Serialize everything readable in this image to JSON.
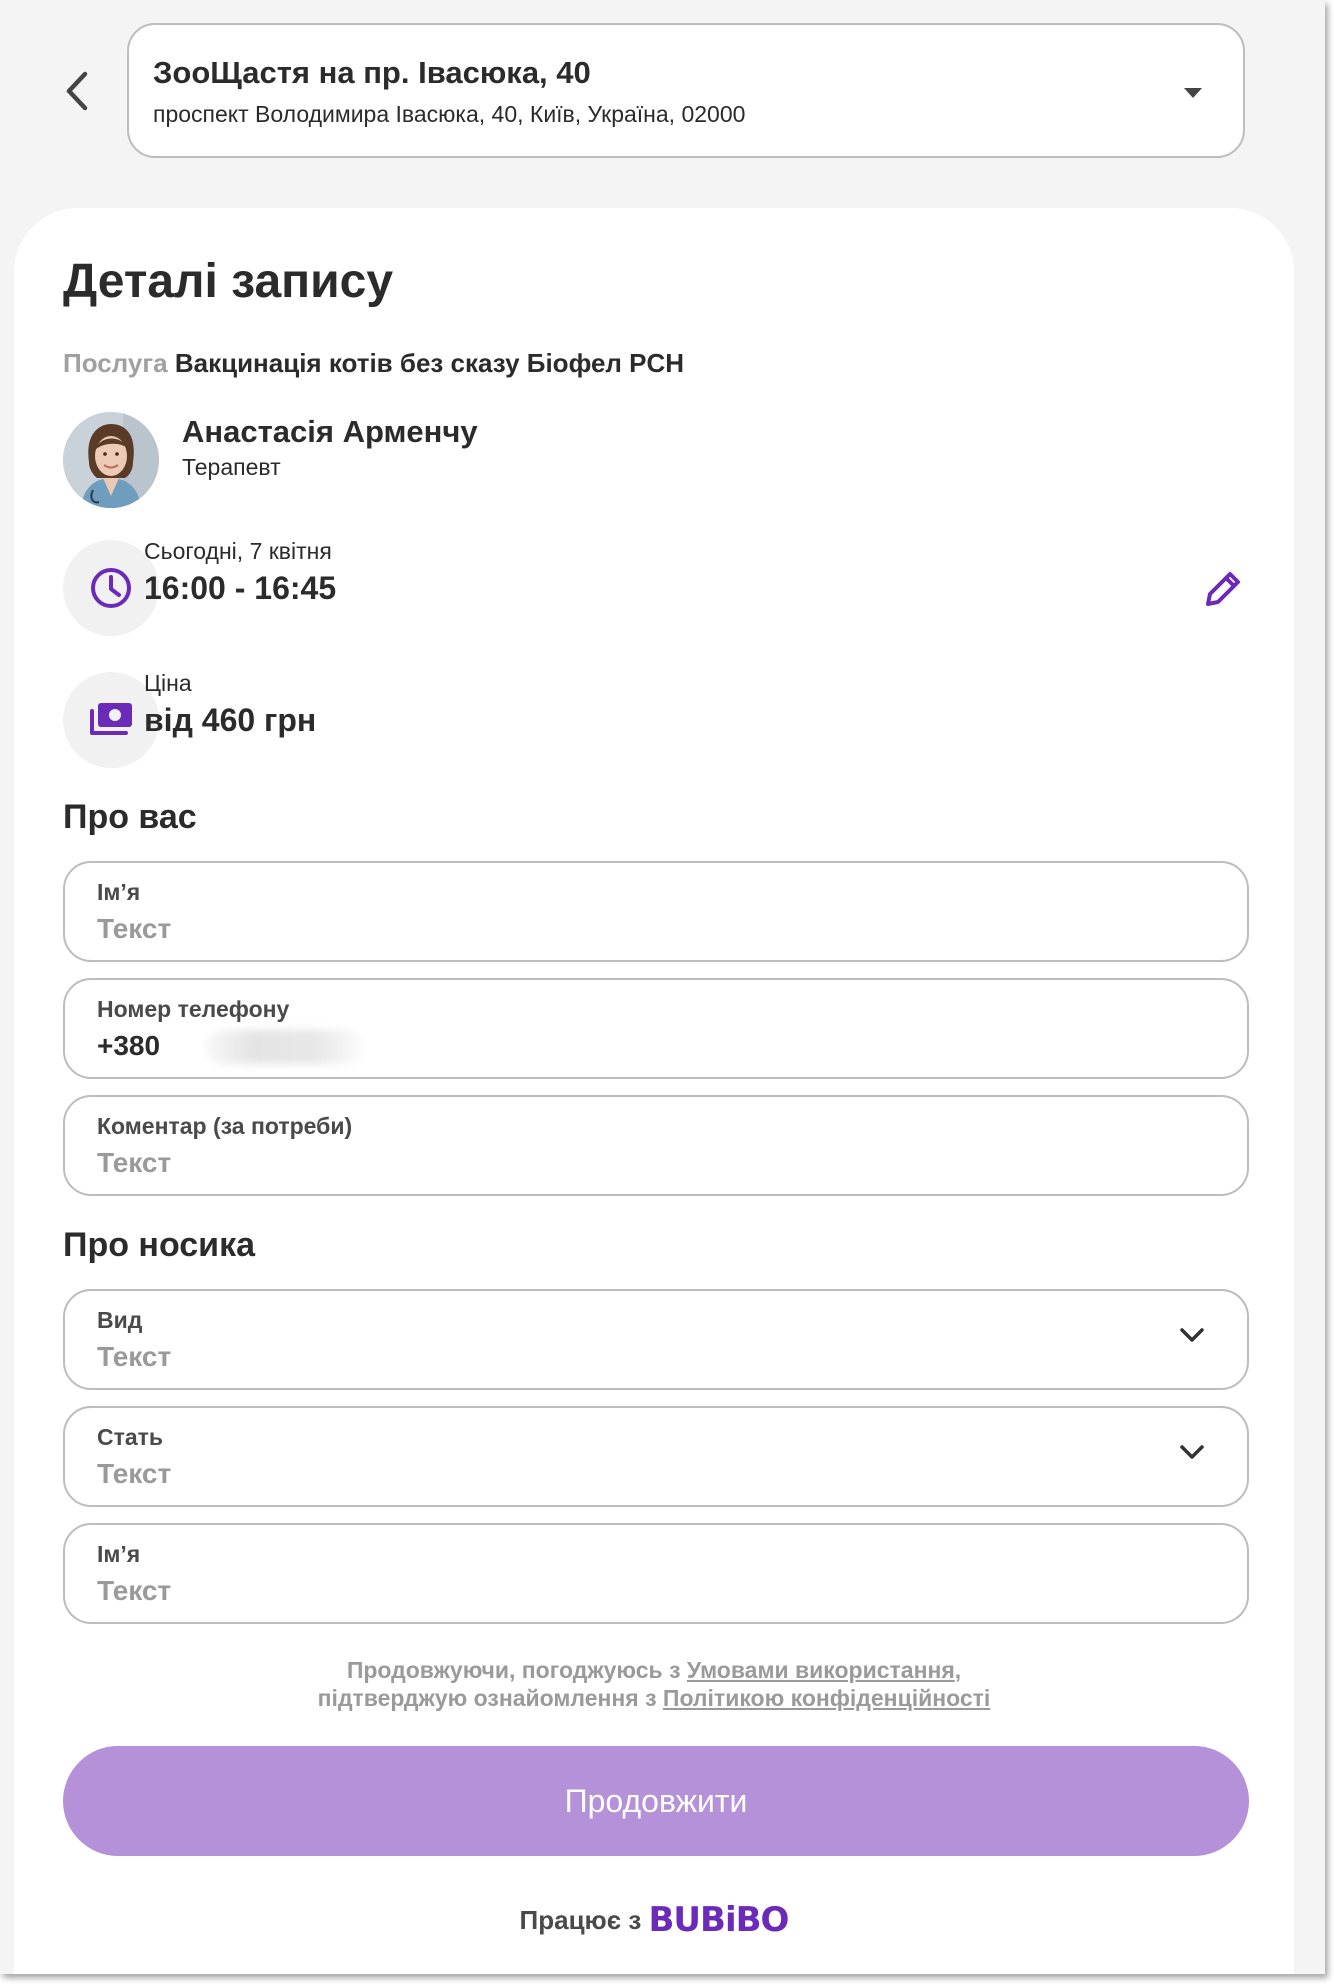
{
  "location": {
    "name": "ЗооЩастя на пр. Івасюка, 40",
    "address": "проспект Володимира Івасюка, 40, Київ, Україна, 02000"
  },
  "details": {
    "title": "Деталі запису",
    "service_label": "Послуга",
    "service_value": "Вакцинація котів без сказу Біофел PCH",
    "specialist_name": "Анастасія Арменчу",
    "specialist_role": "Терапевт",
    "date": "Сьогодні, 7 квітня",
    "time": "16:00 - 16:45",
    "price_label": "Ціна",
    "price_value": "від 460 грн"
  },
  "about_you": {
    "title": "Про вас",
    "fields": [
      {
        "label": "Ім’я",
        "value": "Текст"
      },
      {
        "label": "Номер телефону",
        "value": "+380"
      },
      {
        "label": "Коментар (за потреби)",
        "value": "Текст"
      }
    ]
  },
  "about_pet": {
    "title": "Про носика",
    "fields": [
      {
        "label": "Вид",
        "value": "Текст"
      },
      {
        "label": "Стать",
        "value": "Текст"
      },
      {
        "label": "Ім’я",
        "value": "Текст"
      }
    ]
  },
  "terms": {
    "line1_prefix": "Продовжуючи, погоджуюсь з ",
    "terms_link": "Умовами використання",
    "line1_suffix": ",",
    "line2_prefix": "підтверджую ознайомлення з ",
    "privacy_link": "Політикою конфіденційності"
  },
  "cta_label": "Продовжити",
  "powered_by": "Працює з",
  "brand": "BUBiBO",
  "colors": {
    "accent": "#6b2ab8",
    "button": "#b491d8"
  },
  "icons": [
    "back-icon",
    "caret-down-icon",
    "clock-icon",
    "money-icon",
    "edit-icon",
    "chevron-down-icon"
  ]
}
